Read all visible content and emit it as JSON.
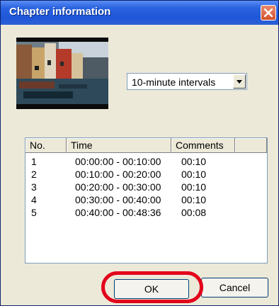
{
  "window": {
    "title": "Chapter information"
  },
  "interval_select": {
    "value": "10-minute intervals"
  },
  "chapter_list": {
    "columns": [
      "No.",
      "Time",
      "Comments"
    ],
    "rows": [
      {
        "no": "1",
        "time": "00:00:00 - 00:10:00",
        "comment": "00:10"
      },
      {
        "no": "2",
        "time": "00:10:00 - 00:20:00",
        "comment": "00:10"
      },
      {
        "no": "3",
        "time": "00:20:00 - 00:30:00",
        "comment": "00:10"
      },
      {
        "no": "4",
        "time": "00:30:00 - 00:40:00",
        "comment": "00:10"
      },
      {
        "no": "5",
        "time": "00:40:00 - 00:48:36",
        "comment": "00:08"
      }
    ]
  },
  "buttons": {
    "ok": "OK",
    "cancel": "Cancel"
  },
  "icons": {
    "close": "close-icon",
    "dropdown": "chevron-down-icon"
  },
  "colors": {
    "title_bar": "#2a63e0",
    "highlight": "#e3001a"
  }
}
